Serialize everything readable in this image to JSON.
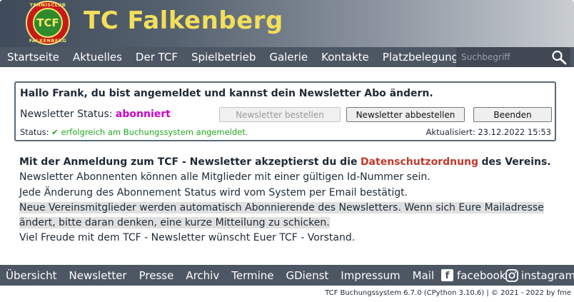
{
  "header": {
    "logo_ring_top": "TENNISCLUB",
    "logo_text": "TCF",
    "logo_ring_bottom": "FALKENBERG",
    "title": "TC Falkenberg"
  },
  "nav": {
    "items": [
      "Startseite",
      "Aktuelles",
      "Der TCF",
      "Spielbetrieb",
      "Galerie",
      "Kontakte",
      "Platzbelegung"
    ],
    "search_placeholder": "Suchbegriff"
  },
  "panel": {
    "greeting": "Hallo Frank, du bist angemeldet und kannst dein Newsletter Abo ändern.",
    "status_label": "Newsletter Status:",
    "status_value": "abonniert",
    "btn_subscribe": "Newsletter bestellen",
    "btn_unsubscribe": "Newsletter abbestellen",
    "btn_exit": "Beenden",
    "status_prefix": "Status:",
    "status_check": "✔",
    "status_message": "erfolgreich am Buchungssystem angemeldet.",
    "updated": "Aktualisiert: 23.12.2022 15:53"
  },
  "info": {
    "p1_bold_a": "Mit der Anmeldung zum TCF - Newsletter akzeptierst du die",
    "p1_link": "Datenschutzordnung",
    "p1_bold_b": "des Vereins.",
    "p1_rest": "Newsletter Abonnenten können alle Mitglieder mit einer gültigen Id-Nummer sein.",
    "p2": "Jede Änderung des Abonnement Status wird vom System per Email bestätigt.",
    "p3": "Neue Vereinsmitglieder werden automatisch Abonnierende des Newsletters. Wenn sich Eure Mailadresse ändert, bitte daran denken, eine kurze Mitteilung zu schicken.",
    "p4": "Viel Freude mit dem TCF - Newsletter wünscht Euer TCF - Vorstand."
  },
  "footer": {
    "items": [
      "Übersicht",
      "Newsletter",
      "Presse",
      "Archiv",
      "Termine",
      "GDienst",
      "Impressum",
      "Mail"
    ],
    "facebook": "facebook",
    "instagram": "instagram",
    "version": "TCF Buchungssystem 6.7.0 (CPython 3.10.6) | © 2021 - 2022 by fme"
  },
  "colors": {
    "nav_bg": "#4d5663",
    "title_yellow": "#f2df5a",
    "status_magenta": "#cc00cc",
    "status_green": "#22aa22",
    "link_red": "#c0392b"
  }
}
